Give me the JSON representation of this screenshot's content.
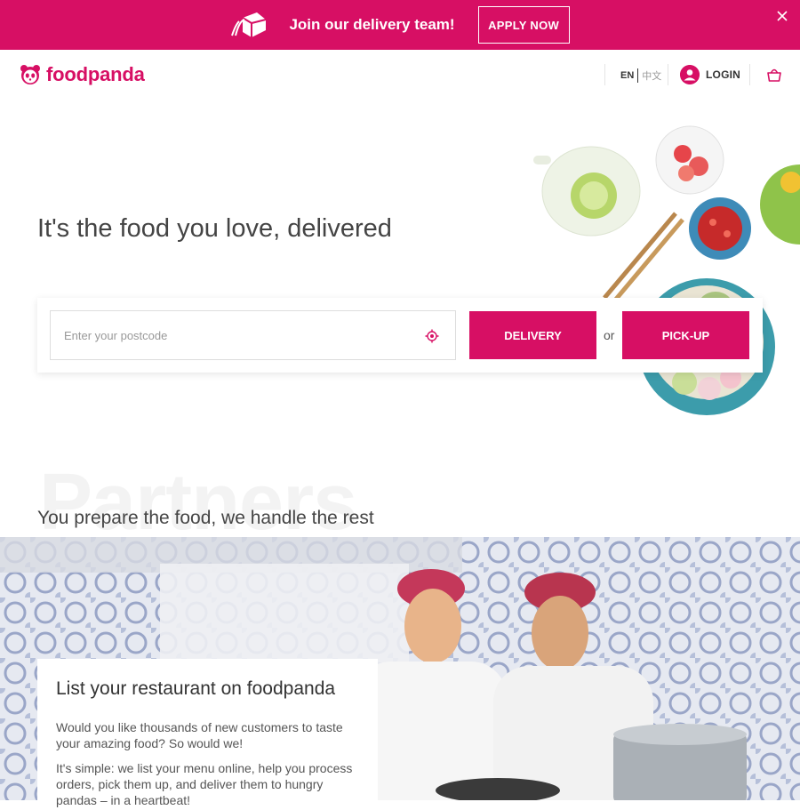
{
  "promo": {
    "text": "Join our delivery team!",
    "button": "APPLY NOW"
  },
  "header": {
    "logo_text": "foodpanda",
    "lang_current": "EN",
    "lang_alt": "中文",
    "login": "LOGIN"
  },
  "hero": {
    "title": "It's the food you love, delivered",
    "postcode_placeholder": "Enter your postcode",
    "delivery_button": "DELIVERY",
    "or": "or",
    "pickup_button": "PICK-UP"
  },
  "partners": {
    "bg_word": "Partners",
    "subtitle": "You prepare the food, we handle the rest",
    "card_title": "List your restaurant on foodpanda",
    "p1": "Would you like thousands of new customers to taste your amazing food? So would we!",
    "p2": "It's simple: we list your menu online, help you process orders, pick them up, and deliver them to hungry pandas – in a heartbeat!"
  },
  "colors": {
    "brand": "#d70f64"
  }
}
